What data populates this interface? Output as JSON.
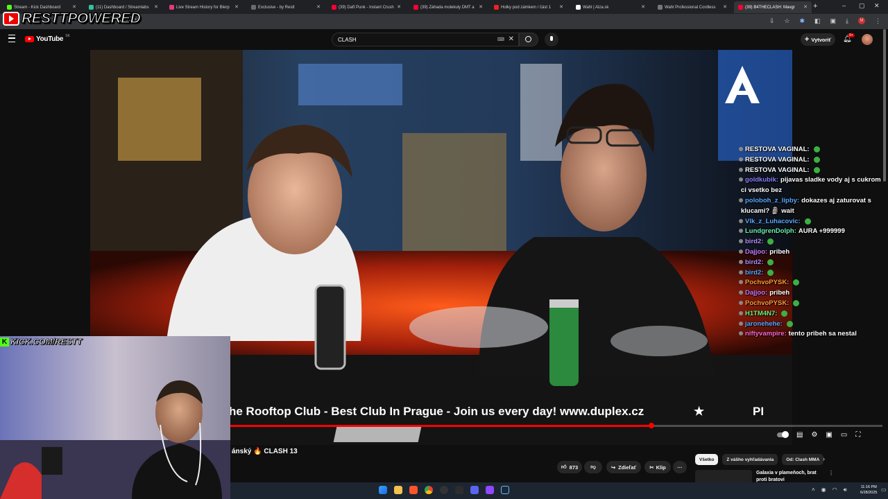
{
  "tabs": [
    {
      "label": "Stream - Kick Dashboard",
      "color": "#53fc18",
      "active": false
    },
    {
      "label": "(11) Dashboard / Streamlabs",
      "color": "#31c3a2",
      "active": false
    },
    {
      "label": "Live Stream History for Blerp",
      "color": "#e6397e",
      "active": false
    },
    {
      "label": "Exclusive - by Restt",
      "color": "#6b6b6b",
      "active": false
    },
    {
      "label": "(39) Daft Punk - Instant Crush",
      "color": "#ff0033",
      "active": false
    },
    {
      "label": "(39) Záhada molekuly DMT a",
      "color": "#ff0033",
      "active": false
    },
    {
      "label": "Holky pod zámkem / část 1",
      "color": "#e22",
      "active": false
    },
    {
      "label": "Wahl | Alza.sk",
      "color": "#fff",
      "active": false
    },
    {
      "label": "Wahl Professional Cordless",
      "color": "#777",
      "active": false
    },
    {
      "label": "(39) B4THECLASH: Mavgr",
      "color": "#ff0033",
      "active": true
    }
  ],
  "overlay": {
    "brand": "RESTTPOWERED",
    "url_fragment": "KuFHmM",
    "kick": "KICK.COM/RESTT"
  },
  "youtube": {
    "logo": "YouTube",
    "country": "SK",
    "search_value": "CLASH",
    "create_label": "Vytvoriť",
    "notif_count": "9+"
  },
  "ticker": {
    "text": "he Rooftop Club - Best Club In Prague - Join us every day! www.duplex.cz",
    "star": "★",
    "tail": "PI"
  },
  "progress": {
    "played_fraction": 0.708
  },
  "video_meta": {
    "title": "ánský 🔥 CLASH 13",
    "likes": "873",
    "share_label": "Zdieľať",
    "clip_label": "Klip",
    "more": "···"
  },
  "filters": [
    {
      "label": "Všetko"
    },
    {
      "label": "Z vášho vyhľadávania"
    },
    {
      "label": "Od: Clash MMA"
    }
  ],
  "recommended": {
    "title": "Galaxia v plameňoch, brat proti bratovi"
  },
  "chat": [
    {
      "user": "RESTOVA VAGINAL:",
      "msg": "",
      "color": "#ffffff"
    },
    {
      "user": "RESTOVA VAGINAL:",
      "msg": "",
      "color": "#ffffff"
    },
    {
      "user": "RESTOVA VAGINAL:",
      "msg": "",
      "color": "#ffffff"
    },
    {
      "user": "goldkubik:",
      "msg": "pijavas sladke vody aj s cukrom",
      "color": "#8b7fff"
    },
    {
      "user": "",
      "msg": "ci vsetko bez",
      "color": "#ffffff"
    },
    {
      "user": "poloboh_z_lipby:",
      "msg": "dokazes aj zaturovat s",
      "color": "#5aa8ff"
    },
    {
      "user": "",
      "msg": "klucami? 🗿 wait",
      "color": "#ffffff"
    },
    {
      "user": "Vlk_z_Luhacovic:",
      "msg": "",
      "color": "#5aa8ff"
    },
    {
      "user": "LundgrenDolph:",
      "msg": "AURA +999999",
      "color": "#6cf2b0"
    },
    {
      "user": "bird2:",
      "msg": "",
      "color": "#b38cff"
    },
    {
      "user": "Dajjoo:",
      "msg": "pribeh",
      "color": "#c67cff"
    },
    {
      "user": "bird2:",
      "msg": "",
      "color": "#b38cff"
    },
    {
      "user": "bird2:",
      "msg": "",
      "color": "#5aa8ff"
    },
    {
      "user": "PochvoPYSK:",
      "msg": "",
      "color": "#ff9c3a"
    },
    {
      "user": "Dajjoo:",
      "msg": "pribeh",
      "color": "#c67cff"
    },
    {
      "user": "PochvoPYSK:",
      "msg": "",
      "color": "#ff9c3a"
    },
    {
      "user": "H1TM4N7:",
      "msg": "",
      "color": "#6cf27a"
    },
    {
      "user": "jaronehehe:",
      "msg": "",
      "color": "#5aa8ff"
    },
    {
      "user": "niftyvampire:",
      "msg": "tento pribeh sa nestal",
      "color": "#ff6bcd"
    }
  ],
  "clock": {
    "time": "11:16 PM",
    "date": "6/28/2025"
  },
  "channel_watermark": "AC"
}
